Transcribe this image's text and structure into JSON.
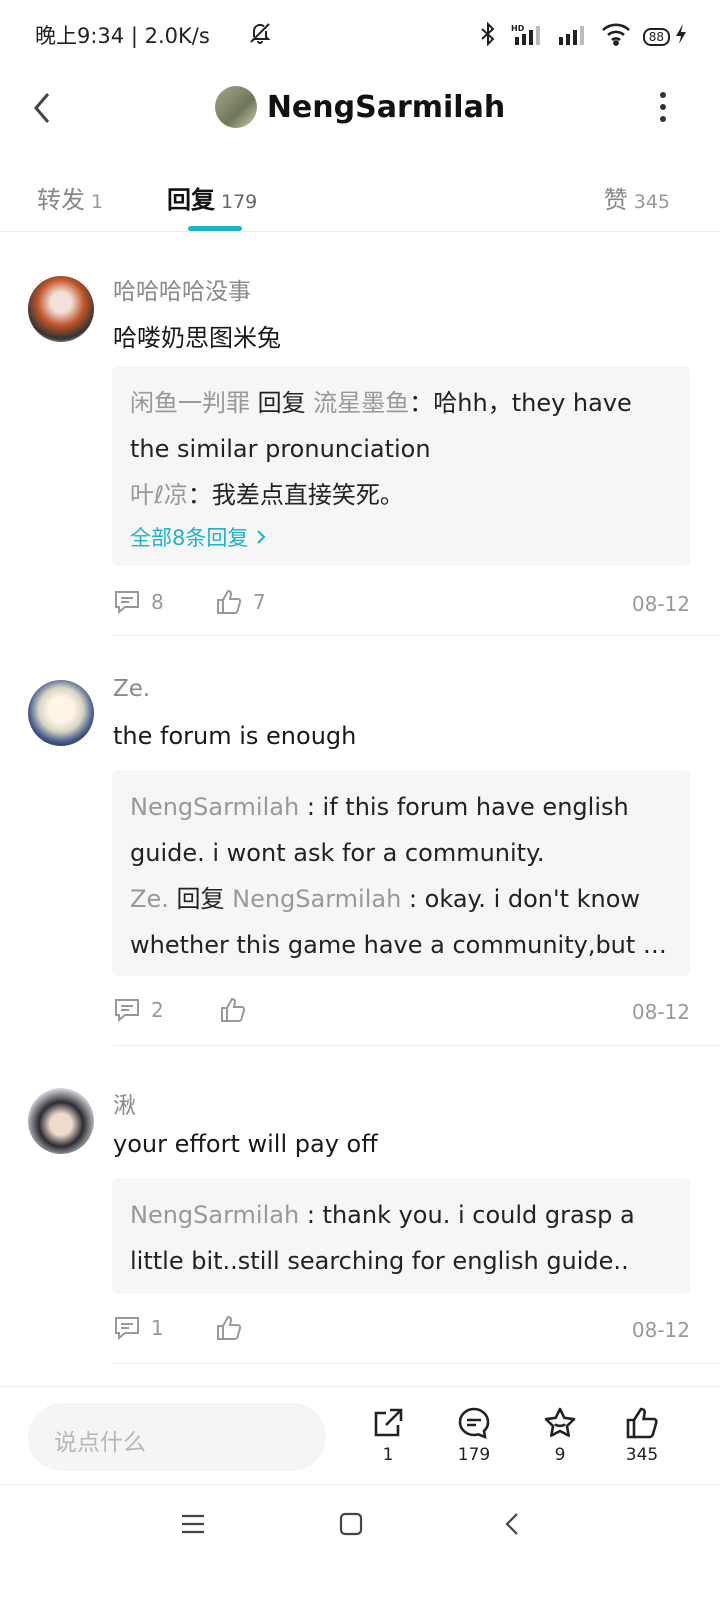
{
  "status_bar": {
    "time": "晚上9:34 | 2.0K/s",
    "battery": "88"
  },
  "header": {
    "title": "NengSarmilah"
  },
  "tabs": [
    {
      "label": "转发",
      "count": "1"
    },
    {
      "label": "回复",
      "count": "179"
    },
    {
      "label": "赞",
      "count": "345"
    }
  ],
  "comments": [
    {
      "name": "哈哈哈哈没事",
      "text": "哈喽奶思图米兔",
      "replies": [
        {
          "user": "闲鱼一判罪",
          "reply_word": "回复",
          "target": "流星墨鱼",
          "text": "：哈hh，they have the similar pronunciation"
        },
        {
          "user": "叶ℓ凉",
          "text": "：我差点直接笑死。"
        }
      ],
      "more_link": "全部8条回复",
      "reply_count": "8",
      "likes": "7",
      "date": "08-12"
    },
    {
      "name": "Ze.",
      "text": "the forum is enough",
      "replies": [
        {
          "user": "NengSarmilah",
          "text": " : if this forum have english guide. i wont ask for a community."
        },
        {
          "user": "Ze.",
          "reply_word": "回复",
          "target": "NengSarmilah",
          "text": " : okay. i don't know whether this game have a community,but …"
        }
      ],
      "reply_count": "2",
      "likes": "",
      "date": "08-12"
    },
    {
      "name": "湫",
      "text": "your effort will pay off",
      "replies": [
        {
          "user": "NengSarmilah",
          "text": " : thank you. i could grasp a little bit..still searching for english guide.."
        }
      ],
      "reply_count": "1",
      "likes": "",
      "date": "08-12"
    }
  ],
  "bottom_bar": {
    "input_placeholder": "说点什么",
    "share_count": "1",
    "comment_count": "179",
    "favorite_count": "9",
    "like_count": "345"
  },
  "colors": {
    "accent": "#1fb2c8"
  }
}
